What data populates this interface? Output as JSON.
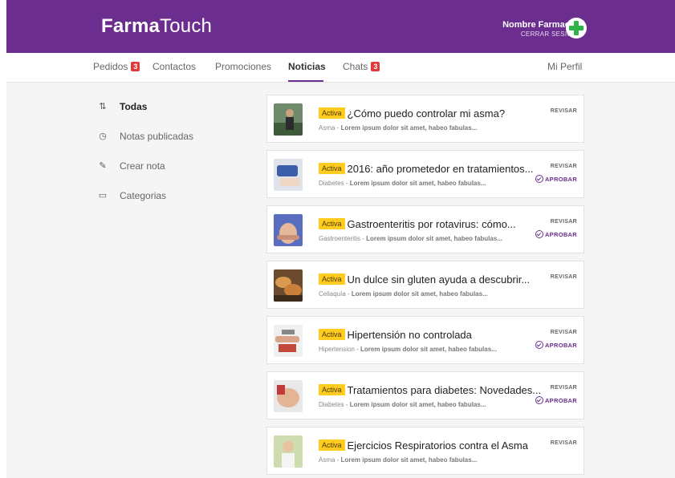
{
  "header": {
    "logo_bold": "Farma",
    "logo_light": "Touch",
    "pharmacy_name": "Nombre Farmacia",
    "logout": "CERRAR SESIÓN",
    "brand_color": "#6b2d8e"
  },
  "nav": {
    "pedidos": "Pedidos",
    "pedidos_badge": "3",
    "contactos": "Contactos",
    "promociones": "Promociones",
    "noticias": "Noticias",
    "chats": "Chats",
    "chats_badge": "3",
    "perfil": "Mi Perfil"
  },
  "sidebar": {
    "items": [
      {
        "label": "Todas",
        "icon": "sort-arrows-icon"
      },
      {
        "label": "Notas publicadas",
        "icon": "clock-icon"
      },
      {
        "label": "Crear nota",
        "icon": "edit-icon"
      },
      {
        "label": "Categorias",
        "icon": "folder-icon"
      }
    ]
  },
  "notes": [
    {
      "tag": "Activa",
      "title": "¿Cómo puedo controlar mi asma?",
      "category": "Asma",
      "excerpt": "Lorem ipsum dolor sit amet, habeo fabulas...",
      "review": "REVISAR",
      "approve": ""
    },
    {
      "tag": "Activa",
      "title": "2016: año prometedor en tratamientos...",
      "category": "Diabetes",
      "excerpt": "Lorem ipsum dolor sit amet, habeo fabulas...",
      "review": "REVISAR",
      "approve": "APROBAR"
    },
    {
      "tag": "Activa",
      "title": "Gastroenteritis por rotavirus: cómo...",
      "category": "Gastroenteritis",
      "excerpt": "Lorem ipsum dolor sit amet, habeo fabulas...",
      "review": "REVISAR",
      "approve": "APROBAR"
    },
    {
      "tag": "Activa",
      "title": "Un dulce sin gluten ayuda a descubrir...",
      "category": "Celiaquía",
      "excerpt": "Lorem ipsum dolor sit amet, habeo fabulas...",
      "review": "REVISAR",
      "approve": ""
    },
    {
      "tag": "Activa",
      "title": "Hipertensión no controlada",
      "category": "Hipertension",
      "excerpt": "Lorem ipsum dolor sit amet, habeo fabulas...",
      "review": "REVISAR",
      "approve": "APROBAR"
    },
    {
      "tag": "Activa",
      "title": "Tratamientos para diabetes: Novedades...",
      "category": "Diabetes",
      "excerpt": "Lorem ipsum dolor sit amet, habeo fabulas...",
      "review": "REVISAR",
      "approve": "APROBAR"
    },
    {
      "tag": "Activa",
      "title": "Ejercicios Respiratorios contra el Asma",
      "category": "Asma",
      "excerpt": "Lorem ipsum dolor sit amet, habeo fabulas...",
      "review": "REVISAR",
      "approve": ""
    }
  ]
}
